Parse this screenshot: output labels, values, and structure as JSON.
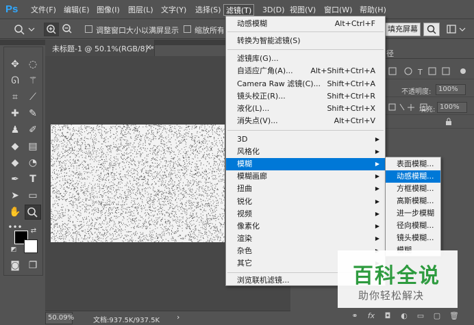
{
  "app": {
    "logo": "Ps",
    "menus": [
      "文件(F)",
      "编辑(E)",
      "图像(I)",
      "图层(L)",
      "文字(Y)",
      "选择(S)",
      "滤镜(T)",
      "3D(D)",
      "视图(V)",
      "窗口(W)",
      "帮助(H)"
    ],
    "active_menu_index": 6
  },
  "options_bar": {
    "resize_windows_label": "调整窗口大小以满屏显示",
    "zoom_all_label": "缩放所有",
    "fill_screen_label": "填充屏幕"
  },
  "document": {
    "tab_label": "未标题-1 @ 50.1%(RGB/8) *",
    "close_glyph": "×"
  },
  "status": {
    "zoom": "50.09%",
    "doc_size": "文档:937.5K/937.5K",
    "arrow": "›"
  },
  "right_panel": {
    "tab_fragment": "径",
    "opacity_label": "不透明度:",
    "opacity_value": "100%",
    "fill_label": "填充:",
    "fill_value": "100%"
  },
  "filter_menu": {
    "items": [
      {
        "label": "动感模糊",
        "shortcut": "Alt+Ctrl+F"
      },
      {
        "label": "转换为智能滤镜(S)",
        "shortcut": ""
      },
      {
        "label": "滤镜库(G)...",
        "shortcut": ""
      },
      {
        "label": "自适应广角(A)...",
        "shortcut": "Alt+Shift+Ctrl+A"
      },
      {
        "label": "Camera Raw 滤镜(C)...",
        "shortcut": "Shift+Ctrl+A"
      },
      {
        "label": "镜头校正(R)...",
        "shortcut": "Shift+Ctrl+R"
      },
      {
        "label": "液化(L)...",
        "shortcut": "Shift+Ctrl+X"
      },
      {
        "label": "消失点(V)...",
        "shortcut": "Alt+Ctrl+V"
      },
      {
        "label": "3D",
        "shortcut": ""
      },
      {
        "label": "风格化",
        "shortcut": ""
      },
      {
        "label": "模糊",
        "shortcut": ""
      },
      {
        "label": "模糊画廊",
        "shortcut": ""
      },
      {
        "label": "扭曲",
        "shortcut": ""
      },
      {
        "label": "锐化",
        "shortcut": ""
      },
      {
        "label": "视频",
        "shortcut": ""
      },
      {
        "label": "像素化",
        "shortcut": ""
      },
      {
        "label": "渲染",
        "shortcut": ""
      },
      {
        "label": "杂色",
        "shortcut": ""
      },
      {
        "label": "其它",
        "shortcut": ""
      },
      {
        "label": "浏览联机滤镜...",
        "shortcut": ""
      }
    ],
    "submenu_arrow": "▶"
  },
  "blur_submenu": {
    "items": [
      "表面模糊...",
      "动感模糊...",
      "方框模糊...",
      "高斯模糊...",
      "进一步模糊",
      "径向模糊...",
      "镜头模糊...",
      "模糊"
    ]
  },
  "watermark": {
    "title": "百科全说",
    "subtitle": "助你轻松解决"
  },
  "colors": {
    "accent": "#0078d7",
    "ps_blue": "#31a8ff",
    "watermark_green": "#2e9b3f"
  }
}
